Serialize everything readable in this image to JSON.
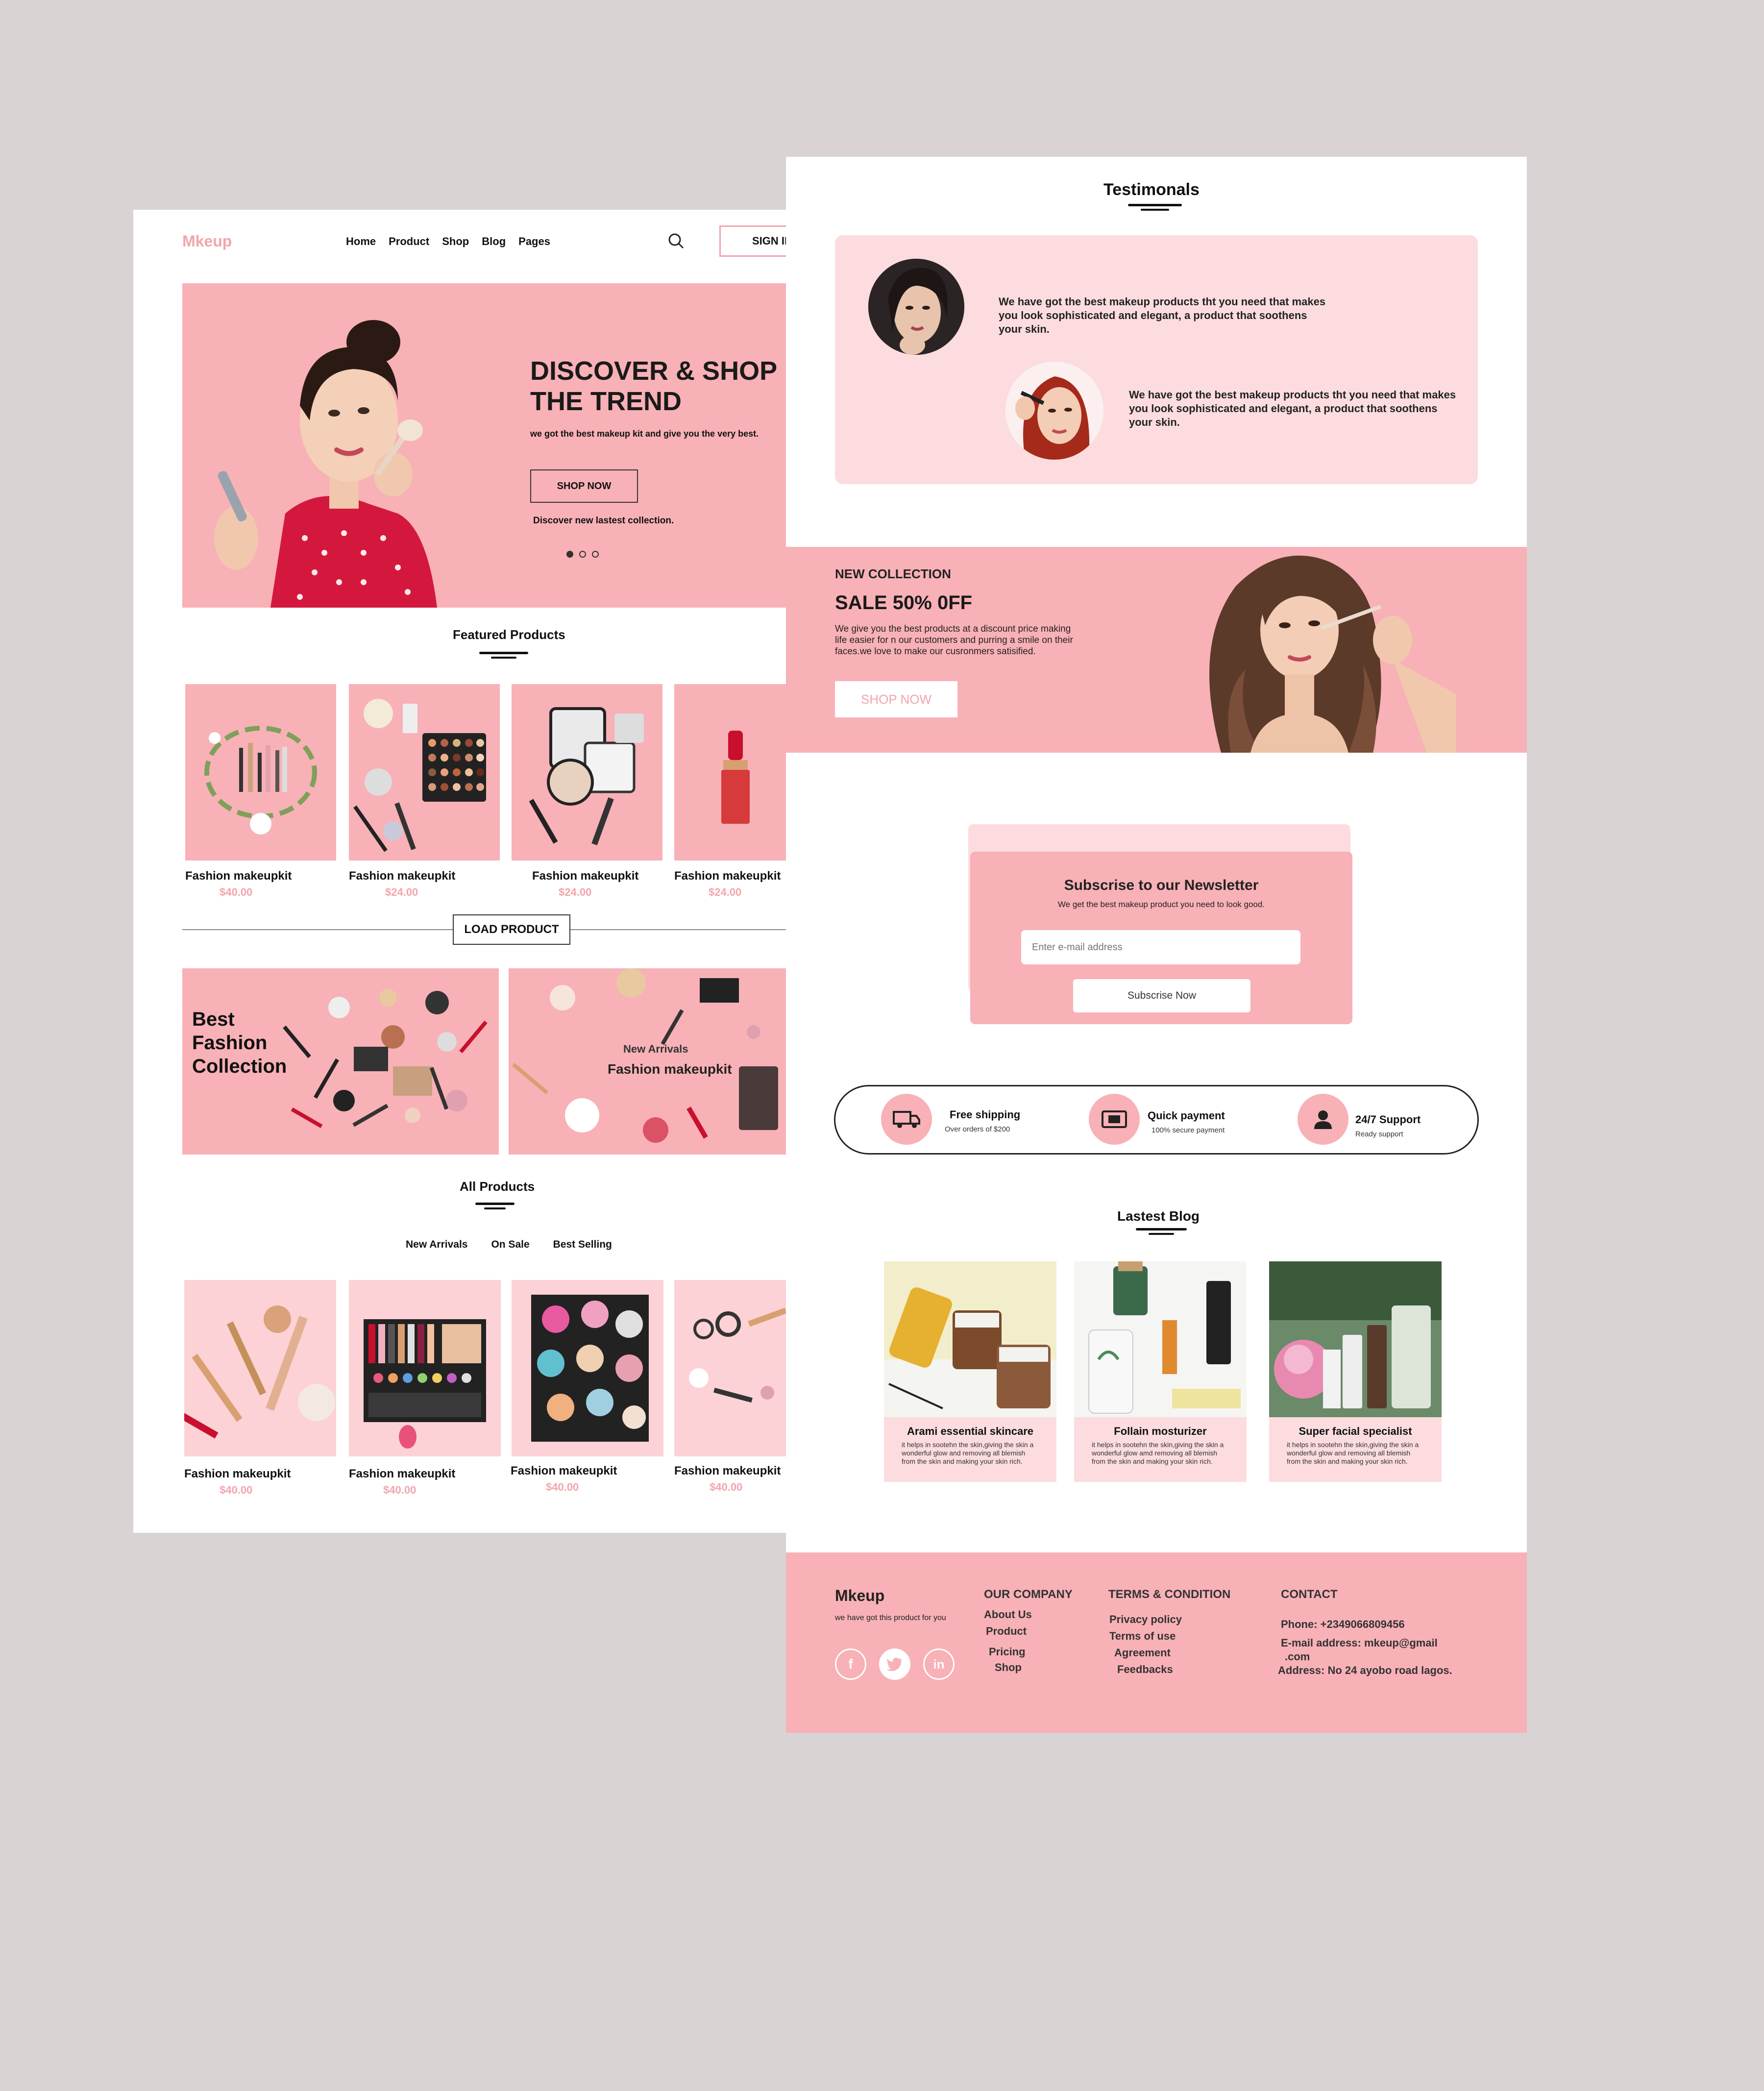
{
  "brand": "Mkeup",
  "nav": {
    "links": [
      "Home",
      "Product",
      "Shop",
      "Blog",
      "Pages"
    ],
    "signin": "SIGN IN"
  },
  "hero": {
    "title_line1": "DISCOVER & SHOP",
    "title_line2": "THE TREND",
    "subtitle": "we got  the best makeup kit and give you the very best.",
    "button": "SHOP NOW",
    "note": "Discover new lastest collection."
  },
  "featured": {
    "heading": "Featured Products",
    "products": [
      {
        "title": "Fashion makeupkit",
        "price": "$40.00"
      },
      {
        "title": "Fashion makeupkit",
        "price": "$24.00"
      },
      {
        "title": "Fashion makeupkit",
        "price": "$24.00"
      },
      {
        "title": "Fashion makeupkit",
        "price": "$24.00"
      }
    ],
    "load_button": "LOAD PRODUCT"
  },
  "banners": {
    "left_line1": "Best",
    "left_line2": "Fashion",
    "left_line3": "Collection",
    "right_small": "New Arrivals",
    "right_big": "Fashion makeupkit"
  },
  "all_products": {
    "heading": "All Products",
    "tabs": [
      "New Arrivals",
      "On Sale",
      "Best Selling"
    ],
    "products": [
      {
        "title": "Fashion makeupkit",
        "price": "$40.00"
      },
      {
        "title": "Fashion makeupkit",
        "price": "$40.00"
      },
      {
        "title": "Fashion makeupkit",
        "price": "$40.00"
      },
      {
        "title": "Fashion makeupkit",
        "price": "$40.00"
      }
    ]
  },
  "testimonials": {
    "heading": "Testimonals",
    "items": [
      {
        "text": "We have got the best makeup products tht you need that makes you look sophisticated and elegant, a product that soothens your skin."
      },
      {
        "text": "We have got the best makeup products tht you need that makes you look sophisticated and elegant, a product that soothens your skin."
      }
    ]
  },
  "sale": {
    "label": "NEW COLLECTION",
    "title": "SALE 50% 0FF",
    "text": "We give you the best products at a discount price making life easier for n our customers and purring a smile on their faces.we love to make our cusronmers  satisified.",
    "button": "SHOP NOW"
  },
  "newsletter": {
    "title": "Subscrise to our Newsletter",
    "subtitle": "We get the best makeup product you need to look good.",
    "placeholder": "Enter e-mail address",
    "button": "Subscrise Now"
  },
  "services": [
    {
      "title": "Free shipping",
      "sub": "Over orders of $200",
      "icon": "truck-icon"
    },
    {
      "title": "Quick payment",
      "sub": "100% secure payment",
      "icon": "payment-icon"
    },
    {
      "title": "24/7 Support",
      "sub": "Ready support",
      "icon": "user-icon"
    }
  ],
  "blog": {
    "heading": "Lastest Blog",
    "posts": [
      {
        "title": "Arami essential skincare",
        "text": "it helps in sootehn the skin,giving the skin a wonderful glow and removing all blemish from the skin and making your skin rich."
      },
      {
        "title": "Follain mosturizer",
        "text": "it helps in sootehn the skin,giving the skin a wonderful glow amd removing all blemish from the skin and making your skin rich."
      },
      {
        "title": "Super facial specialist",
        "text": "it helps in sootehn the skin,giving the skin a wonderful glow and removing all blemish from the skin and making your skin rich."
      }
    ]
  },
  "footer": {
    "brand": "Mkeup",
    "tagline": "we have got this product for you",
    "company_head": "OUR COMPANY",
    "company_links": [
      "About Us",
      "Product",
      "Pricing",
      "Shop"
    ],
    "terms_head": "TERMS & CONDITION",
    "terms_links": [
      "Privacy policy",
      "Terms of use",
      "Agreement",
      "Feedbacks"
    ],
    "contact_head": "CONTACT",
    "phone": "Phone: +2349066809456",
    "email_line1": "E-mail address: mkeup@gmail",
    "email_line2": ".com",
    "address": "Address: No 24 ayobo road lagos.",
    "social_icons": [
      "facebook-icon",
      "twitter-icon",
      "linkedin-icon"
    ]
  },
  "colors": {
    "pink": "#f8b1b6",
    "light_pink": "#fcdcdf",
    "brand_text": "#f2a5ab",
    "background": "#d9d3d4"
  }
}
